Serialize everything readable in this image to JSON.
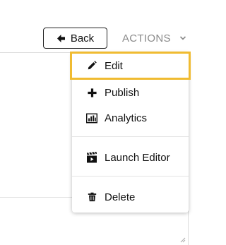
{
  "toolbar": {
    "back_label": "Back",
    "actions_label": "ACTIONS"
  },
  "actions_menu": {
    "items": [
      {
        "label": "Edit",
        "icon": "pencil-icon",
        "highlighted": true
      },
      {
        "label": "Publish",
        "icon": "plus-icon"
      },
      {
        "label": "Analytics",
        "icon": "bar-chart-icon"
      },
      {
        "label": "Launch Editor",
        "icon": "clapperboard-icon"
      },
      {
        "label": "Delete",
        "icon": "trash-icon"
      }
    ]
  },
  "colors": {
    "highlight_border": "#f0bb31",
    "muted_text": "#8a8a8a",
    "text": "#111111"
  }
}
